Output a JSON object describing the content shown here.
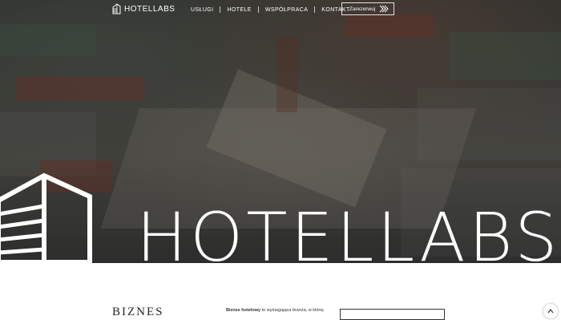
{
  "brand": {
    "name": "HOTELLABS",
    "hero_name": "HOTELLABS"
  },
  "nav": {
    "items": [
      {
        "label": "USŁUGI"
      },
      {
        "label": "HOTELE"
      },
      {
        "label": "WSPÓŁPRACA"
      },
      {
        "label": "KONTAKT"
      }
    ],
    "cta_label": "Zarezerwuj"
  },
  "content": {
    "heading": "BIZNES",
    "paragraph_lead": "Biznes hotelowy",
    "paragraph_rest": " to wymagająca branża, w której"
  },
  "colors": {
    "text_light": "#ffffff",
    "text_dark": "#222222"
  }
}
